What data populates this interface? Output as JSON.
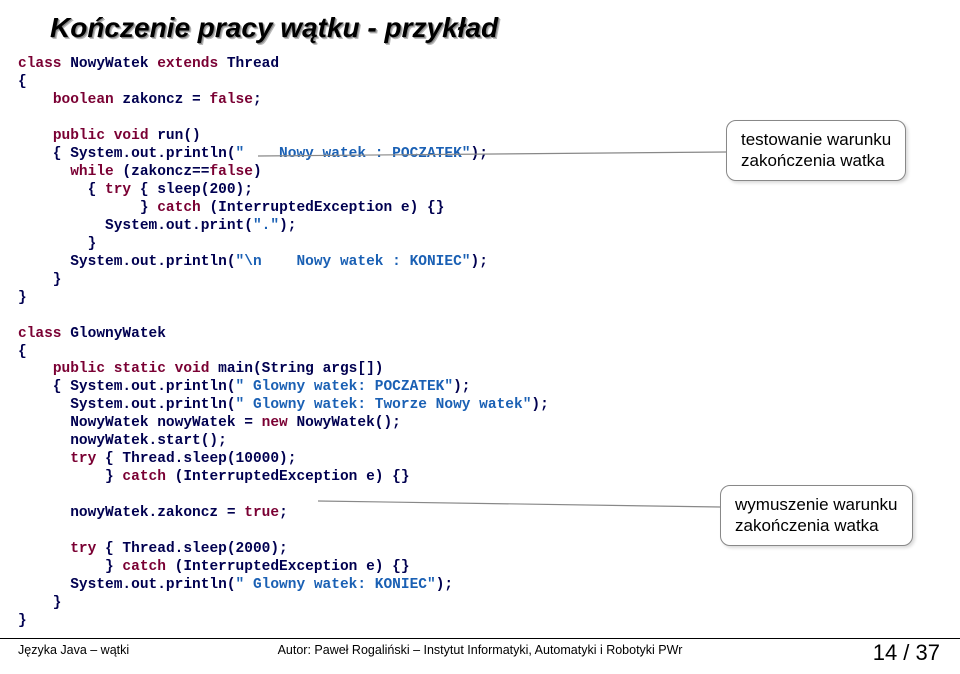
{
  "title": "Kończenie pracy wątku - przykład",
  "annotations": {
    "callout1_line1": "testowanie warunku",
    "callout1_line2": "zakończenia watka",
    "callout2_line1": "wymuszenie warunku",
    "callout2_line2": "zakończenia watka"
  },
  "code": {
    "l1_a": "class",
    "l1_b": " NowyWatek ",
    "l1_c": "extends",
    "l1_d": " Thread",
    "l2": "{",
    "l3_a": "    ",
    "l3_b": "boolean",
    "l3_c": " zakoncz = ",
    "l3_d": "false",
    "l3_e": ";",
    "blank1": "",
    "l4_a": "    ",
    "l4_b": "public void",
    "l4_c": " run()",
    "l5_a": "    { System.out.println(",
    "l5_b": "\"    Nowy watek : POCZATEK\"",
    "l5_c": ");",
    "l6_a": "      ",
    "l6_b": "while",
    "l6_c": " (zakoncz==",
    "l6_d": "false",
    "l6_e": ")",
    "l7_a": "        { ",
    "l7_b": "try",
    "l7_c": " { sleep(200);",
    "l8_a": "              } ",
    "l8_b": "catch",
    "l8_c": " (InterruptedException e) {}",
    "l9_a": "          System.out.print(",
    "l9_b": "\".\"",
    "l9_c": ");",
    "l10": "        }",
    "l11_a": "      System.out.println(",
    "l11_b": "\"\\n    Nowy watek : KONIEC\"",
    "l11_c": ");",
    "l12": "    }",
    "l13": "}",
    "blank2": "",
    "l14_a": "class",
    "l14_b": " GlownyWatek",
    "l15": "{",
    "l16_a": "    ",
    "l16_b": "public static void",
    "l16_c": " main(String args[])",
    "l17_a": "    { System.out.println(",
    "l17_b": "\" Glowny watek: POCZATEK\"",
    "l17_c": ");",
    "l18_a": "      System.out.println(",
    "l18_b": "\" Glowny watek: Tworze Nowy watek\"",
    "l18_c": ");",
    "l19_a": "      NowyWatek nowyWatek = ",
    "l19_b": "new",
    "l19_c": " NowyWatek();",
    "l20": "      nowyWatek.start();",
    "l21_a": "      ",
    "l21_b": "try",
    "l21_c": " { Thread.sleep(10000);",
    "l22_a": "          } ",
    "l22_b": "catch",
    "l22_c": " (InterruptedException e) {}",
    "blank3": "",
    "l23_a": "      nowyWatek.zakoncz = ",
    "l23_b": "true",
    "l23_c": ";",
    "blank4": "",
    "l24_a": "      ",
    "l24_b": "try",
    "l24_c": " { Thread.sleep(2000);",
    "l25_a": "          } ",
    "l25_b": "catch",
    "l25_c": " (InterruptedException e) {}",
    "l26_a": "      System.out.println(",
    "l26_b": "\" Glowny watek: KONIEC\"",
    "l26_c": ");",
    "l27": "    }",
    "l28": "}"
  },
  "footer": {
    "left": "Języka Java – wątki",
    "center": "Autor: Paweł Rogaliński – Instytut Informatyki, Automatyki i Robotyki PWr",
    "page": "14 / 37"
  }
}
